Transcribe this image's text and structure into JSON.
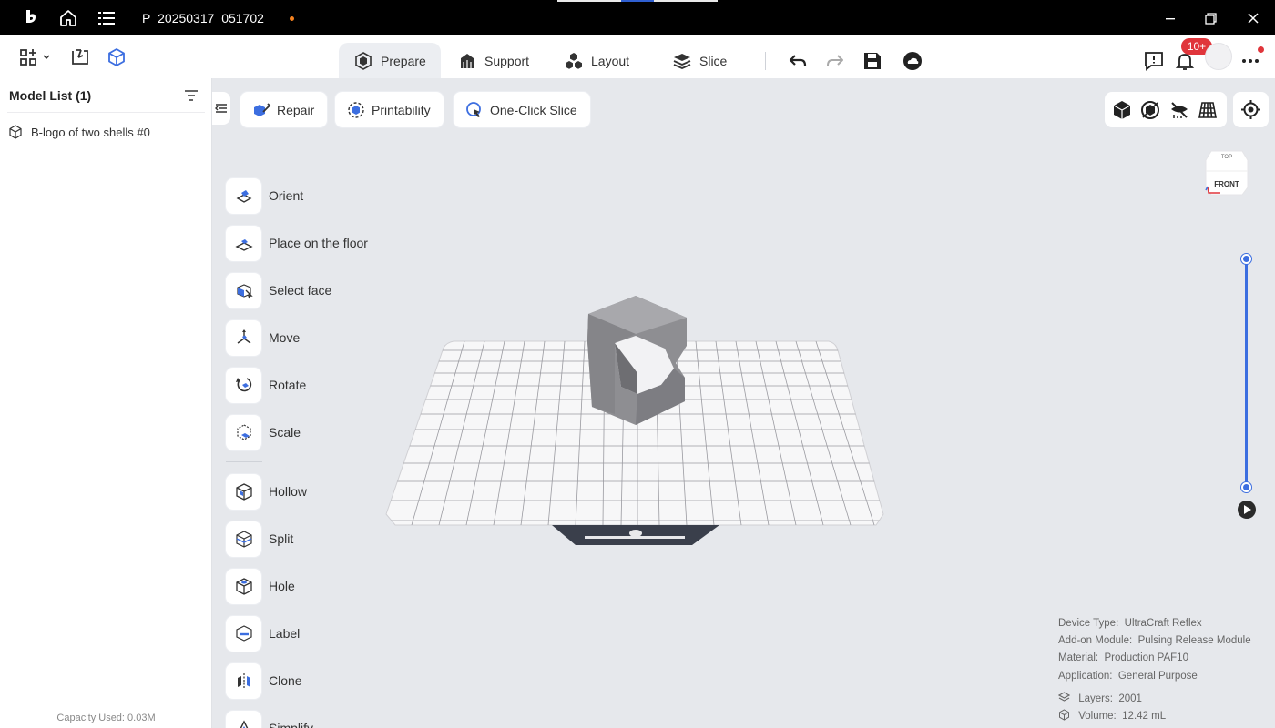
{
  "titlebar": {
    "filename": "P_20250317_051702",
    "icons": [
      "app-logo-icon",
      "home-icon",
      "menu-list-icon"
    ],
    "window_controls": [
      "minimize-icon",
      "restore-icon",
      "close-icon"
    ]
  },
  "toolbar": {
    "tabs": [
      {
        "label": "Prepare",
        "icon": "prepare-icon",
        "active": true
      },
      {
        "label": "Support",
        "icon": "support-icon",
        "active": false
      },
      {
        "label": "Layout",
        "icon": "layout-icon",
        "active": false
      },
      {
        "label": "Slice",
        "icon": "slice-icon",
        "active": false
      }
    ],
    "notification_badge": "10+"
  },
  "model_list": {
    "title": "Model List (1)",
    "items": [
      "B-logo of two shells #0"
    ],
    "capacity": "Capacity Used: 0.03M"
  },
  "actions": {
    "repair": "Repair",
    "printability": "Printability",
    "one_click_slice": "One-Click Slice"
  },
  "navcube": {
    "top": "TOP",
    "front": "FRONT"
  },
  "tools": [
    {
      "label": "Orient",
      "icon": "orient-icon"
    },
    {
      "label": "Place on the floor",
      "icon": "place-floor-icon"
    },
    {
      "label": "Select face",
      "icon": "select-face-icon"
    },
    {
      "label": "Move",
      "icon": "move-icon"
    },
    {
      "label": "Rotate",
      "icon": "rotate-icon"
    },
    {
      "label": "Scale",
      "icon": "scale-icon"
    },
    {
      "label": "Hollow",
      "icon": "hollow-icon"
    },
    {
      "label": "Split",
      "icon": "split-icon"
    },
    {
      "label": "Hole",
      "icon": "hole-icon"
    },
    {
      "label": "Label",
      "icon": "label-icon"
    },
    {
      "label": "Clone",
      "icon": "clone-icon"
    },
    {
      "label": "Simplify",
      "icon": "simplify-icon"
    }
  ],
  "info": {
    "device_type": {
      "label": "Device Type:",
      "value": "UltraCraft Reflex"
    },
    "addon_module": {
      "label": "Add-on Module:",
      "value": "Pulsing Release Module"
    },
    "material": {
      "label": "Material:",
      "value": "Production PAF10"
    },
    "application": {
      "label": "Application:",
      "value": "General Purpose"
    },
    "layers": {
      "label": "Layers:",
      "value": "2001"
    },
    "volume": {
      "label": "Volume:",
      "value": "12.42 mL"
    }
  },
  "colors": {
    "accent": "#3c6ee0",
    "titlebar": "#000000",
    "badge": "#e0353b",
    "unsaved_dot": "#f5821f"
  }
}
